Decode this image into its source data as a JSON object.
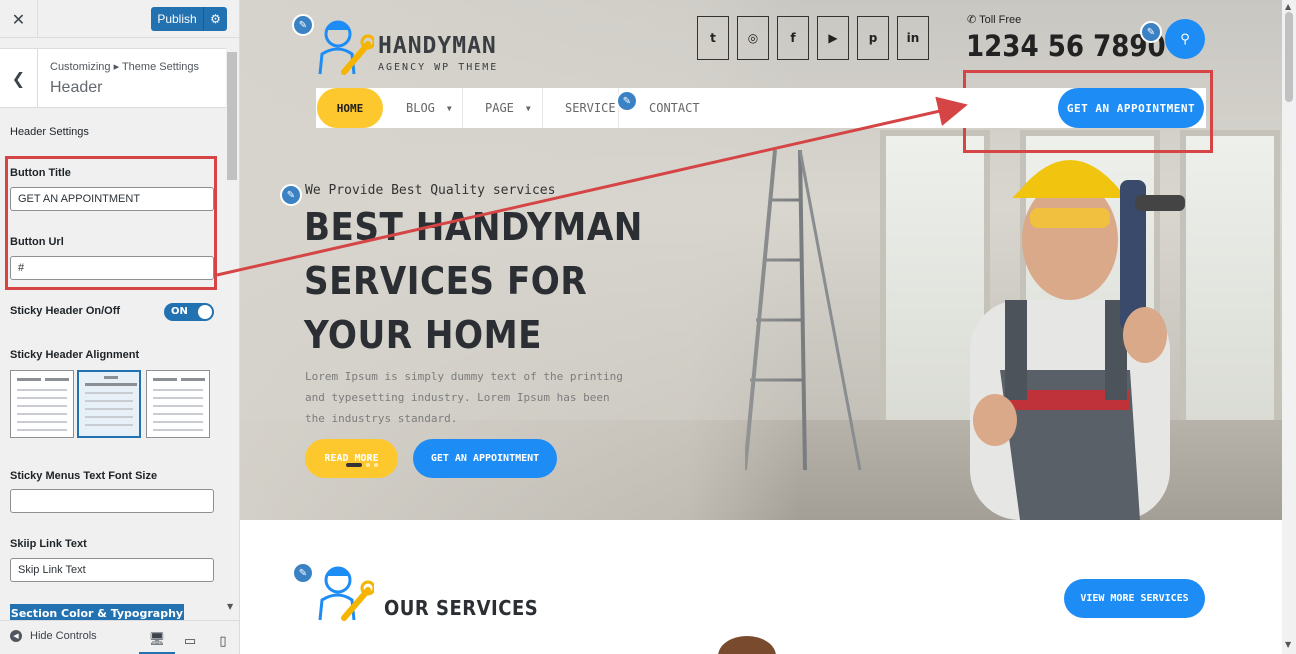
{
  "customizer": {
    "publish_label": "Publish",
    "breadcrumb": "Customizing ▸ Theme Settings",
    "section_title": "Header",
    "group_label": "Header Settings",
    "button_title_label": "Button Title",
    "button_title_value": "GET AN APPOINTMENT",
    "button_url_label": "Button Url",
    "button_url_value": "#",
    "sticky_label": "Sticky Header On/Off",
    "sticky_toggle": "ON",
    "sticky_align_label": "Sticky Header Alignment",
    "sticky_font_label": "Sticky Menus Text Font Size",
    "sticky_font_value": "",
    "skip_link_label": "Skiip Link Text",
    "skip_link_value": "Skip Link Text",
    "section_color_button": "Section Color & Typography",
    "hide_controls": "Hide Controls"
  },
  "site": {
    "logo_word": "HANDYMAN",
    "logo_sub": "AGENCY WP THEME",
    "social_icons": [
      "twitter-icon",
      "instagram-icon",
      "facebook-icon",
      "youtube-icon",
      "pinterest-icon",
      "linkedin-icon"
    ],
    "social_glyphs": [
      "t",
      "◎",
      "f",
      "▶",
      "p",
      "in"
    ],
    "toll_label": "Toll Free",
    "phone": "1234 56 7890",
    "nav": [
      "HOME",
      "BLOG",
      "PAGE",
      "SERVICE",
      "CONTACT"
    ],
    "nav_button": "GET AN APPOINTMENT",
    "tagline": "We Provide Best Quality services",
    "hero_title": "BEST HANDYMAN SERVICES FOR YOUR HOME",
    "hero_text": "Lorem Ipsum is simply dummy text of the printing and typesetting industry. Lorem Ipsum has been the industrys standard.",
    "read_more": "READ MORE",
    "hero_appointment": "GET AN APPOINTMENT",
    "services_title": "OUR SERVICES",
    "view_more": "VIEW MORE SERVICES"
  },
  "colors": {
    "accent_blue": "#1e8cf5",
    "accent_yellow": "#fdc82d",
    "annotation_red": "#d64545",
    "wp_blue": "#2271b1"
  }
}
